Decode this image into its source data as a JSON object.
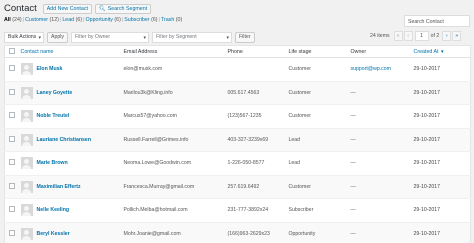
{
  "header": {
    "title": "Contact",
    "add_new_label": "Add New Contact",
    "search_segment_label": "Search Segment"
  },
  "filters": [
    {
      "label": "All",
      "count": "(24)",
      "current": true
    },
    {
      "label": "Customer",
      "count": "(12)",
      "current": false
    },
    {
      "label": "Lead",
      "count": "(6)",
      "current": false
    },
    {
      "label": "Opportunity",
      "count": "(6)",
      "current": false
    },
    {
      "label": "Subscriber",
      "count": "(6)",
      "current": false
    },
    {
      "label": "Trash",
      "count": "(0)",
      "current": false
    }
  ],
  "search": {
    "label": "Search Contact"
  },
  "controls": {
    "bulk_actions": "Bulk Actions",
    "apply_label": "Apply",
    "owner_placeholder": "Filter by Owner",
    "segment_placeholder": "Filter by Segment",
    "filter_label": "Filter"
  },
  "pagination": {
    "items_text": "24 items",
    "first": "«",
    "prev": "‹",
    "current_page": "1",
    "of_text": "of 2",
    "next": "›",
    "last": "»"
  },
  "table": {
    "columns": {
      "name": "Contact name",
      "email": "Email Address",
      "phone": "Phone",
      "stage": "Life stage",
      "owner": "Owner",
      "created": "Created At",
      "created_arrow": "▼"
    },
    "rows": [
      {
        "name": "Elon Musk",
        "email": "elon@musk.com",
        "phone": "",
        "stage": "Customer",
        "owner": "support@wp.com",
        "created": "29-10-2017"
      },
      {
        "name": "Laney Goyette",
        "email": "Marilou3k@Kling.info",
        "phone": "005.617.4563",
        "stage": "Customer",
        "owner": "—",
        "created": "29-10-2017"
      },
      {
        "name": "Noble Treutel",
        "email": "Marcus57@yahoo.com",
        "phone": "(123)567-1235",
        "stage": "Customer",
        "owner": "—",
        "created": "29-10-2017"
      },
      {
        "name": "Lauriane Christiansen",
        "email": "Russell.Farrell@Grimes.info",
        "phone": "403-327-3239x69",
        "stage": "Lead",
        "owner": "—",
        "created": "29-10-2017"
      },
      {
        "name": "Marie Brown",
        "email": "Neoma.Lowe@Goodwin.com",
        "phone": "1-226-050-8577",
        "stage": "Lead",
        "owner": "—",
        "created": "29-10-2017"
      },
      {
        "name": "Maximilian Effertz",
        "email": "Francesca.Murray@gmail.com",
        "phone": "257.619.6492",
        "stage": "Customer",
        "owner": "—",
        "created": "29-10-2017"
      },
      {
        "name": "Nelle Keeling",
        "email": "Pollich.Melba@hotmail.com",
        "phone": "231-777-3892x24",
        "stage": "Subscriber",
        "owner": "—",
        "created": "29-10-2017"
      },
      {
        "name": "Beryl Kessler",
        "email": "Mohr.Joanie@gmail.com",
        "phone": "(166)963-2629x23",
        "stage": "Opportunity",
        "owner": "—",
        "created": "29-10-2017"
      }
    ]
  },
  "colors": {
    "link": "#0073aa",
    "background": "#f1f1f1"
  }
}
